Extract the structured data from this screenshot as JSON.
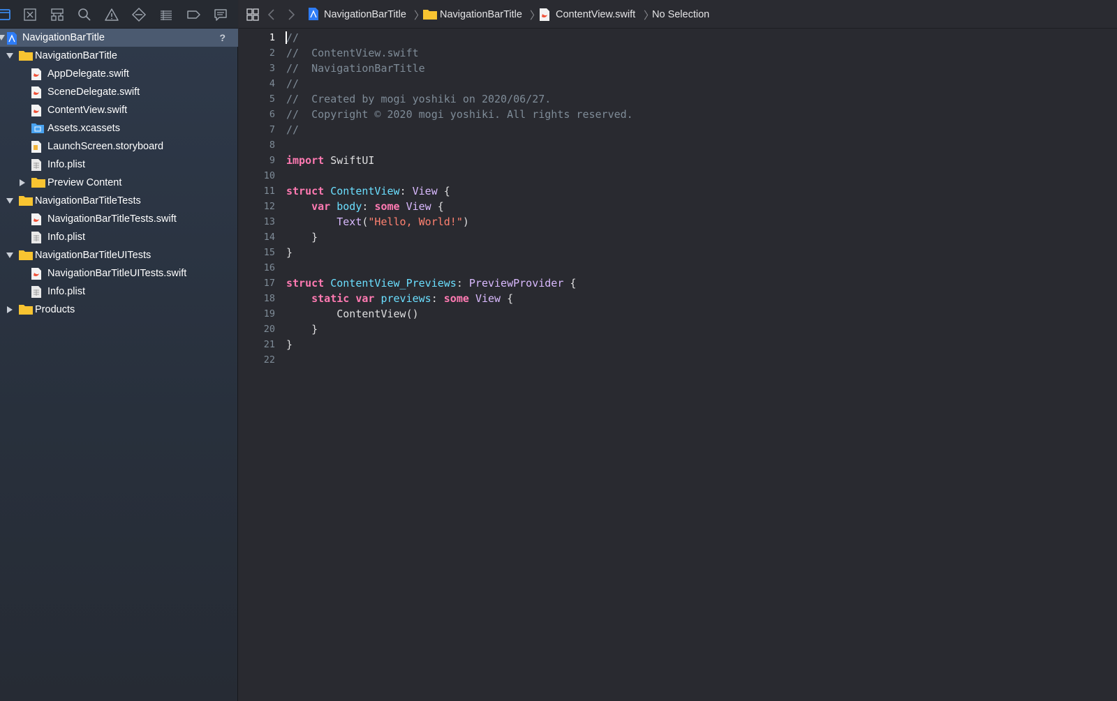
{
  "navigator_toolbar": {
    "icons": [
      "folder-icon",
      "source-control-icon",
      "hierarchy-icon",
      "search-icon",
      "warning-icon",
      "test-icon",
      "debug-icon",
      "breakpoint-icon",
      "report-icon"
    ]
  },
  "tree": [
    {
      "label": "NavigationBarTitle",
      "kind": "project",
      "depth": 0,
      "selected": true,
      "badge": "?"
    },
    {
      "label": "NavigationBarTitle",
      "kind": "folder",
      "depth": 1,
      "expanded": true
    },
    {
      "label": "AppDelegate.swift",
      "kind": "swift",
      "depth": 2
    },
    {
      "label": "SceneDelegate.swift",
      "kind": "swift",
      "depth": 2
    },
    {
      "label": "ContentView.swift",
      "kind": "swift",
      "depth": 2
    },
    {
      "label": "Assets.xcassets",
      "kind": "assets",
      "depth": 2
    },
    {
      "label": "LaunchScreen.storyboard",
      "kind": "storyboard",
      "depth": 2
    },
    {
      "label": "Info.plist",
      "kind": "plist",
      "depth": 2
    },
    {
      "label": "Preview Content",
      "kind": "folder",
      "depth": 2,
      "expanded": false
    },
    {
      "label": "NavigationBarTitleTests",
      "kind": "folder",
      "depth": 1,
      "expanded": true
    },
    {
      "label": "NavigationBarTitleTests.swift",
      "kind": "swift",
      "depth": 2
    },
    {
      "label": "Info.plist",
      "kind": "plist",
      "depth": 2
    },
    {
      "label": "NavigationBarTitleUITests",
      "kind": "folder",
      "depth": 1,
      "expanded": true
    },
    {
      "label": "NavigationBarTitleUITests.swift",
      "kind": "swift",
      "depth": 2
    },
    {
      "label": "Info.plist",
      "kind": "plist",
      "depth": 2
    },
    {
      "label": "Products",
      "kind": "folder",
      "depth": 1,
      "expanded": false
    }
  ],
  "jumpbar": {
    "project": "NavigationBarTitle",
    "group": "NavigationBarTitle",
    "file": "ContentView.swift",
    "symbol": "No Selection"
  },
  "editor": {
    "current_line": 1,
    "lines": [
      [
        [
          "comment",
          "//"
        ]
      ],
      [
        [
          "comment",
          "//  ContentView.swift"
        ]
      ],
      [
        [
          "comment",
          "//  NavigationBarTitle"
        ]
      ],
      [
        [
          "comment",
          "//"
        ]
      ],
      [
        [
          "comment",
          "//  Created by mogi yoshiki on 2020/06/27."
        ]
      ],
      [
        [
          "comment",
          "//  Copyright © 2020 mogi yoshiki. All rights reserved."
        ]
      ],
      [
        [
          "comment",
          "//"
        ]
      ],
      [],
      [
        [
          "keyword",
          "import"
        ],
        [
          "plain",
          " SwiftUI"
        ]
      ],
      [],
      [
        [
          "keyword",
          "struct"
        ],
        [
          "plain",
          " "
        ],
        [
          "decl",
          "ContentView"
        ],
        [
          "plain",
          ": "
        ],
        [
          "type",
          "View"
        ],
        [
          "plain",
          " {"
        ]
      ],
      [
        [
          "plain",
          "    "
        ],
        [
          "keyword",
          "var"
        ],
        [
          "plain",
          " "
        ],
        [
          "decl",
          "body"
        ],
        [
          "plain",
          ": "
        ],
        [
          "keyword",
          "some"
        ],
        [
          "plain",
          " "
        ],
        [
          "type",
          "View"
        ],
        [
          "plain",
          " {"
        ]
      ],
      [
        [
          "plain",
          "        "
        ],
        [
          "type",
          "Text"
        ],
        [
          "plain",
          "("
        ],
        [
          "string",
          "\"Hello, World!\""
        ],
        [
          "plain",
          ")"
        ]
      ],
      [
        [
          "plain",
          "    }"
        ]
      ],
      [
        [
          "plain",
          "}"
        ]
      ],
      [],
      [
        [
          "keyword",
          "struct"
        ],
        [
          "plain",
          " "
        ],
        [
          "decl",
          "ContentView_Previews"
        ],
        [
          "plain",
          ": "
        ],
        [
          "type",
          "PreviewProvider"
        ],
        [
          "plain",
          " {"
        ]
      ],
      [
        [
          "plain",
          "    "
        ],
        [
          "keyword",
          "static"
        ],
        [
          "plain",
          " "
        ],
        [
          "keyword",
          "var"
        ],
        [
          "plain",
          " "
        ],
        [
          "decl",
          "previews"
        ],
        [
          "plain",
          ": "
        ],
        [
          "keyword",
          "some"
        ],
        [
          "plain",
          " "
        ],
        [
          "type",
          "View"
        ],
        [
          "plain",
          " {"
        ]
      ],
      [
        [
          "plain",
          "        ContentView()"
        ]
      ],
      [
        [
          "plain",
          "    }"
        ]
      ],
      [
        [
          "plain",
          "}"
        ]
      ],
      []
    ]
  }
}
